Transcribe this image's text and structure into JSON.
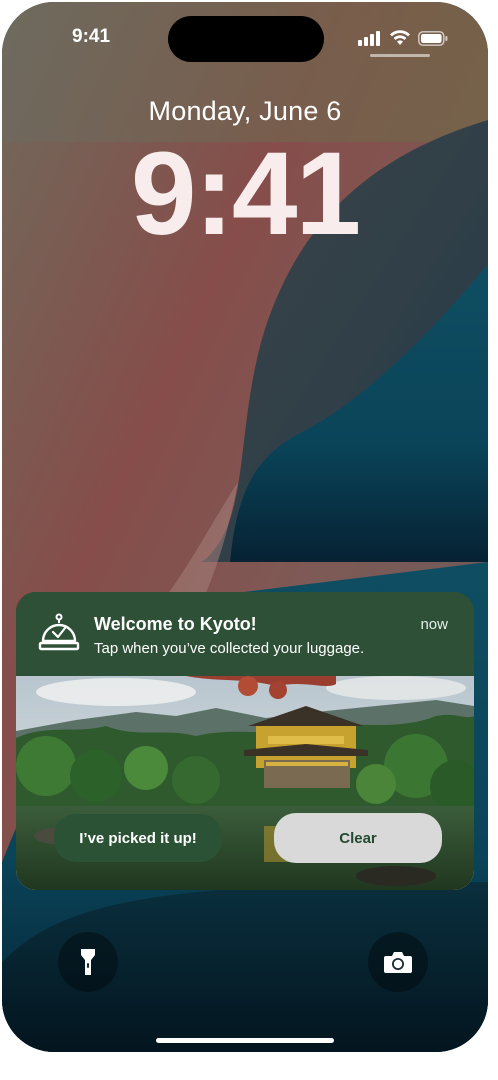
{
  "status_bar": {
    "time": "9:41"
  },
  "lock_screen": {
    "date": "Monday, June 6",
    "time": "9:41"
  },
  "notification": {
    "title": "Welcome to Kyoto!",
    "body": "Tap when you’ve collected your luggage.",
    "timestamp": "now",
    "icon": "concierge-bell-icon",
    "primary_action": "I’ve picked it up!",
    "secondary_action": "Clear",
    "colors": {
      "background": "#2d5036",
      "primary_button": "#2b5235",
      "secondary_button": "#d9d9d9"
    }
  },
  "quick_actions": {
    "left_icon": "flashlight-icon",
    "right_icon": "camera-icon"
  }
}
